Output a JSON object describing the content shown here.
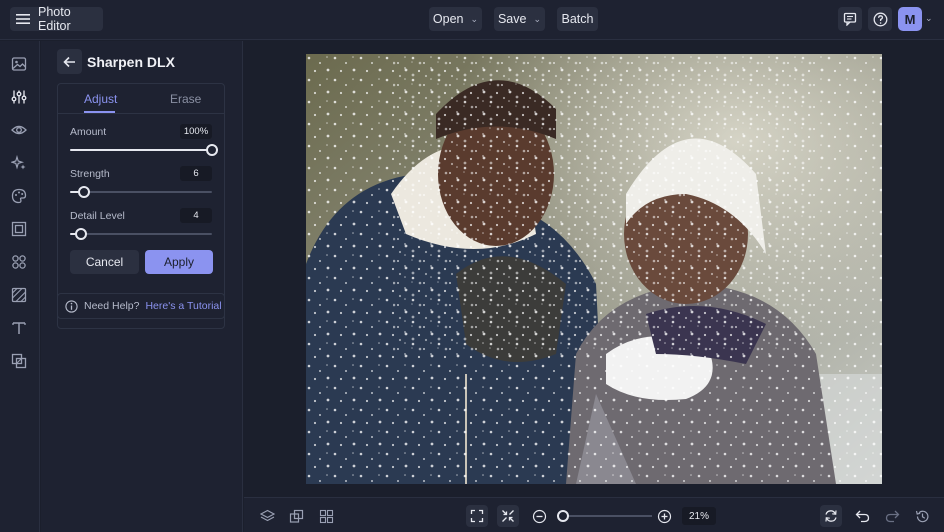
{
  "app": {
    "title": "Photo Editor",
    "avatar_initial": "M"
  },
  "toolbar": {
    "open_label": "Open",
    "save_label": "Save",
    "batch_label": "Batch"
  },
  "tool_panel": {
    "title": "Sharpen DLX",
    "tabs": [
      {
        "label": "Adjust",
        "active": true
      },
      {
        "label": "Erase",
        "active": false
      }
    ],
    "sliders": [
      {
        "label": "Amount",
        "value": "100",
        "unit": "%",
        "fraction": 1.0
      },
      {
        "label": "Strength",
        "value": "6",
        "unit": "",
        "fraction": 0.1
      },
      {
        "label": "Detail Level",
        "value": "4",
        "unit": "",
        "fraction": 0.08
      }
    ],
    "cancel_label": "Cancel",
    "apply_label": "Apply",
    "help_text": "Need Help?",
    "help_link": "Here's a Tutorial"
  },
  "zoom": {
    "value": "21",
    "unit": "%",
    "fraction": 0.0
  },
  "colors": {
    "accent": "#8b93f0",
    "background": "#1b1f2c",
    "panel": "#1e2231",
    "button": "#2b3040"
  },
  "icons": {
    "leftbar": [
      "image-icon",
      "sliders-icon",
      "eye-icon",
      "sparkle-icon",
      "palette-icon",
      "frame-icon",
      "shapes-icon",
      "texture-icon",
      "text-icon",
      "overlay-icon"
    ],
    "bottombar": [
      "layers-icon",
      "swap-icon",
      "grid-icon",
      "fit-screen-icon",
      "actual-size-icon",
      "zoom-out-icon",
      "zoom-in-icon",
      "compare-icon",
      "undo-icon",
      "redo-icon",
      "history-icon"
    ]
  }
}
